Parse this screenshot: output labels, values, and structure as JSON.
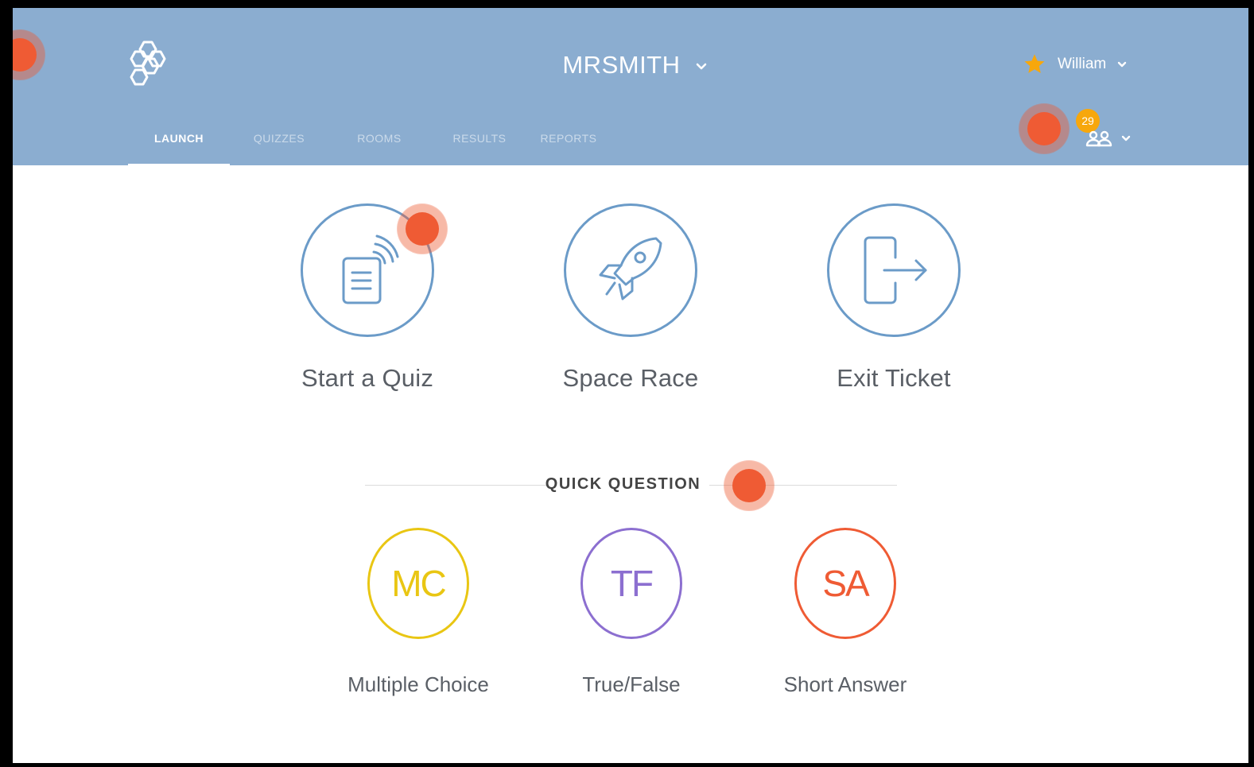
{
  "header": {
    "class_name": "MRSMITH",
    "user_name": "William",
    "rooms_badge_count": "29",
    "colors": {
      "bar": "#8badd0",
      "star": "#f7a70c",
      "hotspot": "#ef5b34"
    }
  },
  "tabs": [
    {
      "label": "LAUNCH",
      "active": true
    },
    {
      "label": "QUIZZES",
      "active": false
    },
    {
      "label": "ROOMS",
      "active": false
    },
    {
      "label": "RESULTS",
      "active": false
    },
    {
      "label": "REPORTS",
      "active": false
    }
  ],
  "launch": [
    {
      "label": "Start a Quiz",
      "icon": "quiz-document-icon"
    },
    {
      "label": "Space Race",
      "icon": "rocket-icon"
    },
    {
      "label": "Exit Ticket",
      "icon": "exit-door-icon"
    }
  ],
  "quick_question": {
    "title": "QUICK QUESTION",
    "items": [
      {
        "abbr": "MC",
        "label": "Multiple Choice",
        "color": "#e9c613"
      },
      {
        "abbr": "TF",
        "label": "True/False",
        "color": "#8c6fd0"
      },
      {
        "abbr": "SA",
        "label": "Short Answer",
        "color": "#ef5b34"
      }
    ]
  }
}
